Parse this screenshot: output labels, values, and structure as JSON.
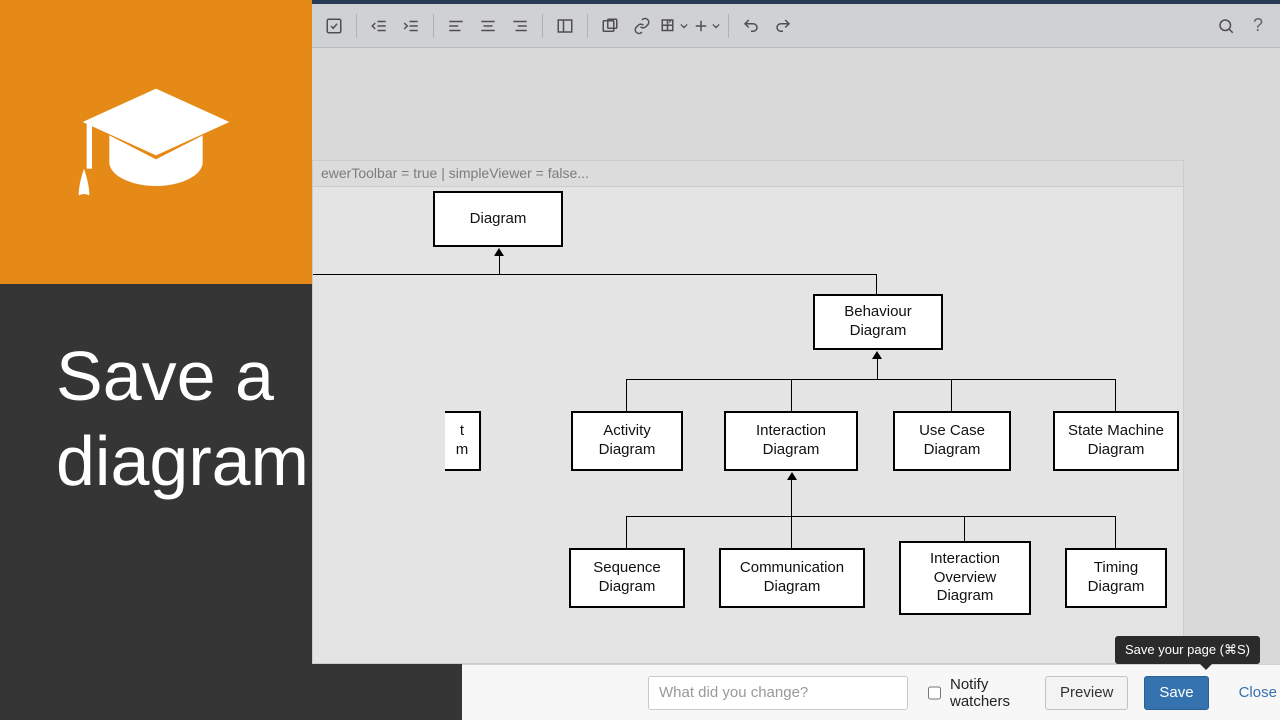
{
  "toolbar_icons": [
    "task-list-icon",
    "outdent-icon",
    "indent-icon",
    "align-left-icon",
    "align-center-icon",
    "align-right-icon",
    "layout-icon",
    "macro-icon",
    "link-icon",
    "table-icon",
    "insert-icon",
    "undo-icon",
    "redo-icon",
    "search-icon",
    "help-icon"
  ],
  "macro_line": "ewerToolbar = true | simpleViewer = false...",
  "caption": "Save a\ndiagram",
  "diagram": {
    "root": "Diagram",
    "behaviour": "Behaviour\nDiagram",
    "row2_partial": "t\nm",
    "row2": [
      "Activity\nDiagram",
      "Interaction\nDiagram",
      "Use Case\nDiagram",
      "State Machine\nDiagram"
    ],
    "row3": [
      "Sequence\nDiagram",
      "Communication\nDiagram",
      "Interaction\nOverview\nDiagram",
      "Timing\nDiagram"
    ]
  },
  "footer": {
    "placeholder": "What did you change?",
    "notify": "Notify watchers",
    "preview": "Preview",
    "save": "Save",
    "close": "Close"
  },
  "tooltip": "Save your page (⌘S)"
}
